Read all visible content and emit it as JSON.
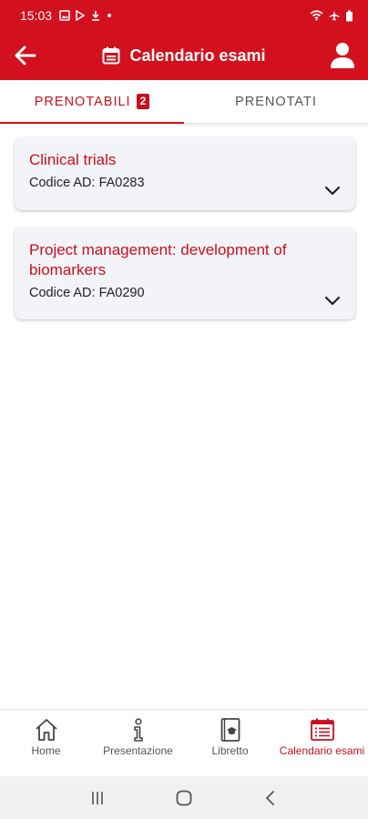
{
  "status_bar": {
    "time": "15:03"
  },
  "app_bar": {
    "title": "Calendario esami",
    "back_icon": "arrow-left-icon",
    "title_icon": "calendar-icon",
    "user_icon": "user-icon"
  },
  "tabs": [
    {
      "label": "PRENOTABILI",
      "badge": "2",
      "active": true
    },
    {
      "label": "PRENOTATI",
      "active": false
    }
  ],
  "exams": [
    {
      "title": "Clinical trials",
      "code": "Codice AD: FA0283"
    },
    {
      "title": "Project management: development of biomarkers",
      "code": "Codice AD: FA0290"
    }
  ],
  "bottom_nav": [
    {
      "label": "Home",
      "icon": "home-icon"
    },
    {
      "label": "Presentazione",
      "icon": "info-icon"
    },
    {
      "label": "Libretto",
      "icon": "booklet-icon"
    },
    {
      "label": "Calendario esami",
      "icon": "calendar-list-icon",
      "active": true
    }
  ],
  "colors": {
    "primary": "#d2101e",
    "accent_text": "#c8101d",
    "card_bg": "#f3f4f8"
  }
}
